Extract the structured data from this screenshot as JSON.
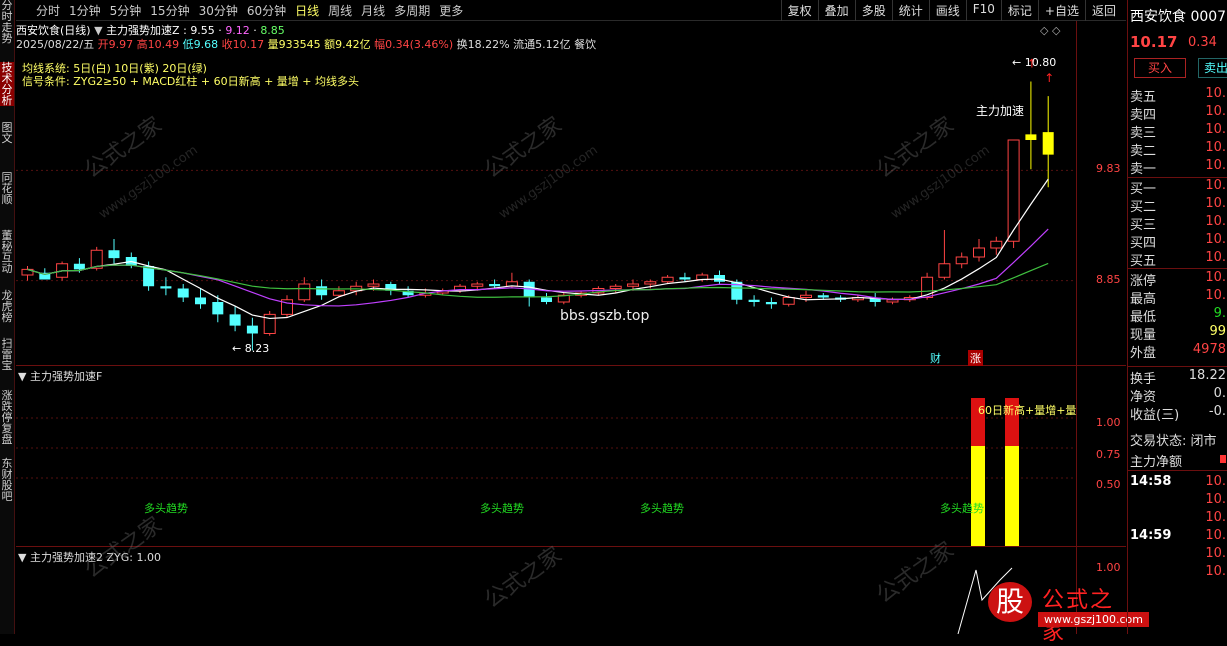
{
  "toolbar": {
    "periods": [
      "分时",
      "1分钟",
      "5分钟",
      "15分钟",
      "30分钟",
      "60分钟",
      "日线",
      "周线",
      "月线",
      "多周期",
      "更多"
    ],
    "active_period": "日线",
    "tools": [
      "复权",
      "叠加",
      "多股",
      "统计",
      "画线",
      "F10",
      "标记",
      "+自选",
      "返回"
    ]
  },
  "leftbar": [
    "分时走势",
    "技术分析",
    "图文",
    "同花顺",
    "董秘互动",
    "龙虎榜",
    "扫雷宝",
    "涨跌停复盘",
    "东财股吧"
  ],
  "main": {
    "stock_label": "西安饮食(日线)",
    "indicator_name": "主力强势加速Z",
    "ma1": "9.55",
    "ma2": "9.12",
    "ma3": "8.85",
    "ohlc_line": {
      "date": "2025/08/22/五",
      "open": "开9.97",
      "high": "高10.49",
      "low": "低9.68",
      "close": "收10.17",
      "volume": "量933545",
      "amount": "额9.42亿",
      "change": "幅0.34(3.46%)",
      "turnover": "换18.22%",
      "float": "流通5.12亿",
      "sector": "餐饮"
    },
    "ma_system": "均线系统: 5日(白) 10日(紫) 20日(绿)",
    "signal": "信号条件: ZYG2≥50 + MACD红柱 + 60日新高 + 量增 + 均线多头",
    "price_high": "10.80",
    "price_low": "8.23",
    "axis": [
      "9.83",
      "8.85"
    ],
    "annotation": "主力加速",
    "tags": [
      "财",
      "涨"
    ],
    "url_watermark": "bbs.gszb.top"
  },
  "panel2": {
    "title": "主力强势加速F",
    "axis": [
      "1.00",
      "0.75",
      "0.50"
    ],
    "labels": [
      "多头趋势",
      "多头趋势",
      "多头趋势",
      "多头趋势"
    ],
    "top_label": "60日新高+量增+量"
  },
  "panel3": {
    "title": "主力强势加速2",
    "value": "ZYG: 1.00",
    "axis": [
      "1.00"
    ]
  },
  "right": {
    "name": "西安饮食",
    "code": "0007",
    "price": "10.17",
    "change": "0.34",
    "buy": "买入",
    "sell": "卖出",
    "sells": [
      "卖五",
      "卖四",
      "卖三",
      "卖二",
      "卖一"
    ],
    "buys": [
      "买一",
      "买二",
      "买三",
      "买四",
      "买五"
    ],
    "sell_vals": [
      "10.",
      "10.",
      "10.",
      "10.",
      "10."
    ],
    "buy_vals": [
      "10.",
      "10.",
      "10.",
      "10.",
      "10."
    ],
    "stats": [
      {
        "l": "涨停",
        "v": "10."
      },
      {
        "l": "最高",
        "v": "10."
      },
      {
        "l": "最低",
        "v": "9."
      },
      {
        "l": "现量",
        "v": "99"
      },
      {
        "l": "外盘",
        "v": "4978"
      }
    ],
    "stats2": [
      {
        "l": "换手",
        "v": "18.22"
      },
      {
        "l": "净资",
        "v": "0."
      },
      {
        "l": "收益(三)",
        "v": "-0."
      }
    ],
    "status": "交易状态: 闭市",
    "flow": "主力净额",
    "ticks": [
      {
        "t": "14:58",
        "v": "10."
      },
      {
        "t": "",
        "v": "10."
      },
      {
        "t": "",
        "v": "10."
      },
      {
        "t": "14:59",
        "v": "10."
      },
      {
        "t": "",
        "v": "10."
      },
      {
        "t": "",
        "v": "10."
      }
    ]
  },
  "logo": {
    "char": "股",
    "name": "公式之家",
    "url": "www.gszj100.com"
  },
  "watermark_text": "公式之家",
  "watermark_url": "www.gszj100.com",
  "colors": {
    "up": "#ff4444",
    "down": "#54ffff",
    "accent": "#ffff00",
    "ma5": "#ffffff",
    "ma10": "#c040ff",
    "ma20": "#40c040"
  },
  "chart_data": {
    "type": "candlestick",
    "candles": [
      [
        8.9,
        8.98,
        8.95,
        8.85
      ],
      [
        8.92,
        8.96,
        8.86,
        8.86
      ],
      [
        8.88,
        9.02,
        9.0,
        8.85
      ],
      [
        9.0,
        9.05,
        8.95,
        8.92
      ],
      [
        8.96,
        9.15,
        9.12,
        8.94
      ],
      [
        9.12,
        9.22,
        9.05,
        9.0
      ],
      [
        9.06,
        9.1,
        8.98,
        8.96
      ],
      [
        8.98,
        9.02,
        8.8,
        8.76
      ],
      [
        8.8,
        8.88,
        8.78,
        8.72
      ],
      [
        8.78,
        8.82,
        8.7,
        8.66
      ],
      [
        8.7,
        8.78,
        8.64,
        8.6
      ],
      [
        8.66,
        8.72,
        8.55,
        8.48
      ],
      [
        8.55,
        8.62,
        8.45,
        8.4
      ],
      [
        8.45,
        8.52,
        8.38,
        8.23
      ],
      [
        8.38,
        8.58,
        8.55,
        8.36
      ],
      [
        8.55,
        8.72,
        8.68,
        8.52
      ],
      [
        8.68,
        8.88,
        8.82,
        8.66
      ],
      [
        8.8,
        8.86,
        8.72,
        8.68
      ],
      [
        8.72,
        8.8,
        8.76,
        8.7
      ],
      [
        8.76,
        8.84,
        8.8,
        8.72
      ],
      [
        8.8,
        8.86,
        8.82,
        8.76
      ],
      [
        8.82,
        8.84,
        8.76,
        8.72
      ],
      [
        8.76,
        8.8,
        8.72,
        8.7
      ],
      [
        8.72,
        8.78,
        8.74,
        8.7
      ],
      [
        8.74,
        8.78,
        8.76,
        8.72
      ],
      [
        8.76,
        8.82,
        8.8,
        8.74
      ],
      [
        8.8,
        8.84,
        8.82,
        8.76
      ],
      [
        8.82,
        8.86,
        8.8,
        8.78
      ],
      [
        8.8,
        8.92,
        8.84,
        8.78
      ],
      [
        8.84,
        8.86,
        8.7,
        8.62
      ],
      [
        8.7,
        8.74,
        8.66,
        8.64
      ],
      [
        8.66,
        8.74,
        8.72,
        8.64
      ],
      [
        8.72,
        8.76,
        8.74,
        8.7
      ],
      [
        8.74,
        8.8,
        8.78,
        8.72
      ],
      [
        8.78,
        8.82,
        8.8,
        8.74
      ],
      [
        8.8,
        8.86,
        8.82,
        8.76
      ],
      [
        8.82,
        8.86,
        8.84,
        8.78
      ],
      [
        8.84,
        8.9,
        8.88,
        8.82
      ],
      [
        8.88,
        8.92,
        8.86,
        8.84
      ],
      [
        8.86,
        8.92,
        8.9,
        8.84
      ],
      [
        8.9,
        8.94,
        8.84,
        8.82
      ],
      [
        8.84,
        8.86,
        8.68,
        8.64
      ],
      [
        8.68,
        8.72,
        8.66,
        8.62
      ],
      [
        8.66,
        8.7,
        8.64,
        8.6
      ],
      [
        8.64,
        8.72,
        8.7,
        8.62
      ],
      [
        8.7,
        8.76,
        8.72,
        8.66
      ],
      [
        8.72,
        8.74,
        8.7,
        8.68
      ],
      [
        8.7,
        8.72,
        8.68,
        8.66
      ],
      [
        8.68,
        8.72,
        8.7,
        8.66
      ],
      [
        8.7,
        8.74,
        8.66,
        8.62
      ],
      [
        8.66,
        8.7,
        8.68,
        8.64
      ],
      [
        8.68,
        8.72,
        8.7,
        8.66
      ],
      [
        8.7,
        8.92,
        8.88,
        8.68
      ],
      [
        8.88,
        9.3,
        9.0,
        8.86
      ],
      [
        9.0,
        9.1,
        9.06,
        8.96
      ],
      [
        9.06,
        9.22,
        9.14,
        9.02
      ],
      [
        9.14,
        9.24,
        9.2,
        9.08
      ],
      [
        9.2,
        10.1,
        10.1,
        9.14
      ],
      [
        10.1,
        10.62,
        10.15,
        9.84
      ],
      [
        9.97,
        10.49,
        10.17,
        9.68
      ]
    ],
    "ylim": [
      8.1,
      10.9
    ]
  }
}
